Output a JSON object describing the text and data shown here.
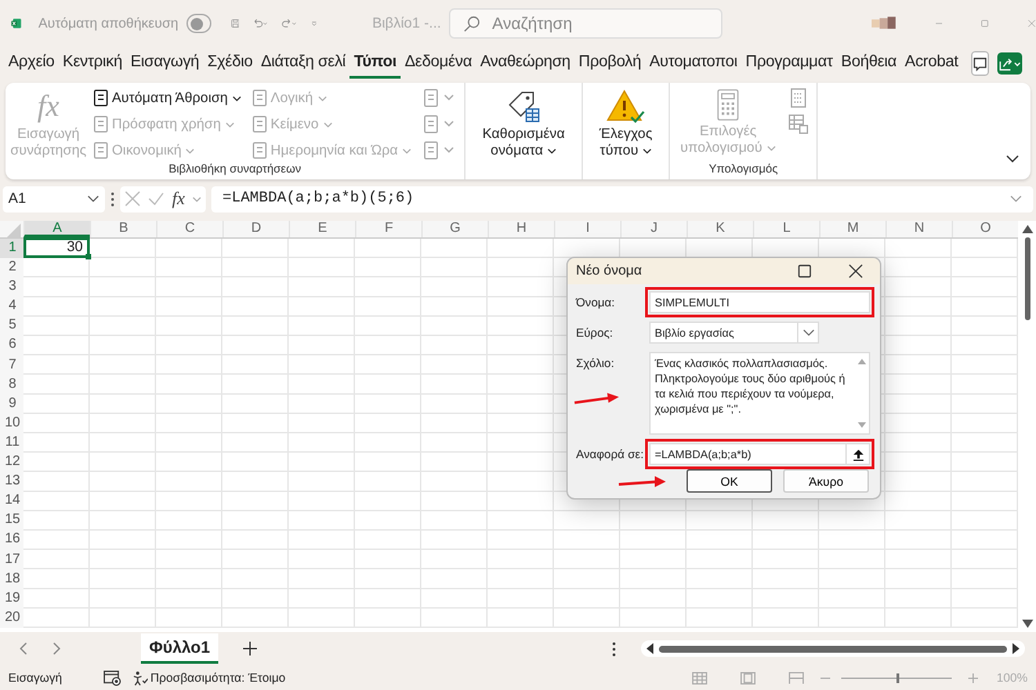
{
  "titlebar": {
    "autosave_label": "Αυτόματη αποθήκευση",
    "autosave_on": false,
    "doc_title": "Βιβλίο1 -...",
    "search": {
      "placeholder": "Αναζήτηση"
    }
  },
  "tabs": [
    {
      "label": "Αρχείο",
      "selected": false
    },
    {
      "label": "Κεντρική",
      "selected": false
    },
    {
      "label": "Εισαγωγή",
      "selected": false
    },
    {
      "label": "Σχέδιο",
      "selected": false
    },
    {
      "label": "Διάταξη σελί",
      "selected": false
    },
    {
      "label": "Τύποι",
      "selected": true
    },
    {
      "label": "Δεδομένα",
      "selected": false
    },
    {
      "label": "Αναθεώρηση",
      "selected": false
    },
    {
      "label": "Προβολή",
      "selected": false
    },
    {
      "label": "Αυτοματοποι",
      "selected": false
    },
    {
      "label": "Προγραμματ",
      "selected": false
    },
    {
      "label": "Βοήθεια",
      "selected": false
    },
    {
      "label": "Acrobat",
      "selected": false
    }
  ],
  "ribbon": {
    "function_library": {
      "label": "Βιβλιοθήκη συναρτήσεων",
      "insert_function": {
        "glyph": "fx",
        "label": "Εισαγωγή συνάρτησης",
        "disabled": true
      },
      "items": [
        {
          "label": "Αυτόματη Άθροιση",
          "disabled": false
        },
        {
          "label": "Πρόσφατη χρήση",
          "disabled": true
        },
        {
          "label": "Οικονομική",
          "disabled": true
        },
        {
          "label": "Λογική",
          "disabled": true
        },
        {
          "label": "Κείμενο",
          "disabled": true
        },
        {
          "label": "Ημερομηνία και Ώρα",
          "disabled": true
        }
      ]
    },
    "defined_names": {
      "label": "Καθορισμένα ονόματα",
      "disabled": false
    },
    "formula_auditing": {
      "label": "Έλεγχος τύπου",
      "disabled": false
    },
    "calculation": {
      "label": "Υπολογισμός",
      "options": {
        "label": "Επιλογές υπολογισμού",
        "disabled": true
      }
    }
  },
  "formula_bar": {
    "name_box": "A1",
    "fx_glyph": "fx",
    "formula": "=LAMBDA(a;b;a*b)(5;6)"
  },
  "grid": {
    "columns": [
      {
        "label": "A",
        "selected": true
      },
      {
        "label": "B",
        "selected": false
      },
      {
        "label": "C",
        "selected": false
      },
      {
        "label": "D",
        "selected": false
      },
      {
        "label": "E",
        "selected": false
      },
      {
        "label": "F",
        "selected": false
      },
      {
        "label": "G",
        "selected": false
      },
      {
        "label": "H",
        "selected": false
      },
      {
        "label": "I",
        "selected": false
      },
      {
        "label": "J",
        "selected": false
      },
      {
        "label": "K",
        "selected": false
      },
      {
        "label": "L",
        "selected": false
      },
      {
        "label": "M",
        "selected": false
      },
      {
        "label": "N",
        "selected": false
      },
      {
        "label": "O",
        "selected": false
      }
    ],
    "rows": [
      {
        "label": "1",
        "selected": true,
        "cells": [
          {
            "value": "30",
            "selected": true
          }
        ]
      },
      {
        "label": "2",
        "selected": false
      },
      {
        "label": "3",
        "selected": false
      },
      {
        "label": "4",
        "selected": false
      },
      {
        "label": "5",
        "selected": false
      },
      {
        "label": "6",
        "selected": false
      },
      {
        "label": "7",
        "selected": false
      },
      {
        "label": "8",
        "selected": false
      },
      {
        "label": "9",
        "selected": false
      },
      {
        "label": "10",
        "selected": false
      },
      {
        "label": "11",
        "selected": false
      },
      {
        "label": "12",
        "selected": false
      },
      {
        "label": "13",
        "selected": false
      },
      {
        "label": "14",
        "selected": false
      },
      {
        "label": "15",
        "selected": false
      },
      {
        "label": "16",
        "selected": false
      },
      {
        "label": "17",
        "selected": false
      },
      {
        "label": "18",
        "selected": false
      },
      {
        "label": "19",
        "selected": false
      },
      {
        "label": "20",
        "selected": false
      }
    ]
  },
  "dialog": {
    "title": "Νέο όνομα",
    "fields": [
      {
        "kind": "text",
        "label": "Όνομα:",
        "value": "SIMPLEMULTI",
        "highlighted": true,
        "arrow": false
      },
      {
        "kind": "dropdown",
        "label": "Εύρος:",
        "value": "Βιβλίο εργασίας",
        "highlighted": false,
        "arrow": false
      },
      {
        "kind": "textarea",
        "label": "Σχόλιο:",
        "value": "Ένας κλασικός πολλαπλασιασμός. Πληκτρολογούμε τους δύο αριθμούς ή τα κελιά που περιέχουν τα νούμερα, χωρισμένα με \";\".",
        "highlighted": false,
        "arrow": true
      },
      {
        "kind": "reference",
        "label": "Αναφορά σε:",
        "value": "=LAMBDA(a;b;a*b)",
        "highlighted": true,
        "arrow": false
      }
    ],
    "buttons": [
      {
        "label": "OK",
        "default": true,
        "arrow": true
      },
      {
        "label": "Άκυρο",
        "default": false,
        "arrow": false
      }
    ]
  },
  "sheet_bar": {
    "sheets": [
      {
        "label": "Φύλλο1",
        "selected": true
      }
    ]
  },
  "status_bar": {
    "mode": "Εισαγωγή",
    "accessibility": "Προσβασιμότητα: Έτοιμο",
    "zoom": {
      "level": 0.5,
      "reading": "100%"
    }
  }
}
